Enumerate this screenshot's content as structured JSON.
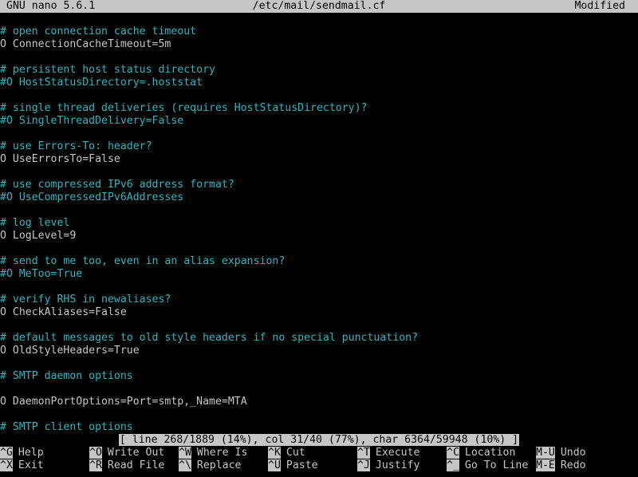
{
  "title_bar": {
    "app": "GNU nano 5.6.1",
    "file": "/etc/mail/sendmail.cf",
    "state": "Modified"
  },
  "lines": [
    {
      "text": "# open connection cache timeout",
      "kind": "comment"
    },
    {
      "text": "O ConnectionCacheTimeout=5m",
      "kind": "code"
    },
    {
      "text": "",
      "kind": "code"
    },
    {
      "text": "# persistent host status directory",
      "kind": "comment"
    },
    {
      "text": "#O HostStatusDirectory=.hoststat",
      "kind": "comment"
    },
    {
      "text": "",
      "kind": "code"
    },
    {
      "text": "# single thread deliveries (requires HostStatusDirectory)?",
      "kind": "comment"
    },
    {
      "text": "#O SingleThreadDelivery=False",
      "kind": "comment"
    },
    {
      "text": "",
      "kind": "code"
    },
    {
      "text": "# use Errors-To: header?",
      "kind": "comment"
    },
    {
      "text": "O UseErrorsTo=False",
      "kind": "code"
    },
    {
      "text": "",
      "kind": "code"
    },
    {
      "text": "# use compressed IPv6 address format?",
      "kind": "comment"
    },
    {
      "text": "#O UseCompressedIPv6Addresses",
      "kind": "comment"
    },
    {
      "text": "",
      "kind": "code"
    },
    {
      "text": "# log level",
      "kind": "comment"
    },
    {
      "text": "O LogLevel=9",
      "kind": "code"
    },
    {
      "text": "",
      "kind": "code"
    },
    {
      "text": "# send to me too, even in an alias expansion?",
      "kind": "comment"
    },
    {
      "text": "#O MeToo=True",
      "kind": "comment"
    },
    {
      "text": "",
      "kind": "code"
    },
    {
      "text": "# verify RHS in newaliases?",
      "kind": "comment"
    },
    {
      "text": "O CheckAliases=False",
      "kind": "code"
    },
    {
      "text": "",
      "kind": "code"
    },
    {
      "text": "# default messages to old style headers if no special punctuation?",
      "kind": "comment"
    },
    {
      "text": "O OldStyleHeaders=True",
      "kind": "code"
    },
    {
      "text": "",
      "kind": "code"
    },
    {
      "text": "# SMTP daemon options",
      "kind": "comment"
    },
    {
      "text": "",
      "kind": "code"
    },
    {
      "text": "O DaemonPortOptions=Port=smtp,_Name=MTA",
      "kind": "code"
    },
    {
      "text": "",
      "kind": "code"
    },
    {
      "text": "# SMTP client options",
      "kind": "comment"
    }
  ],
  "status": "[ line 268/1889 (14%), col 31/40 (77%), char 6364/59948 (10%) ]",
  "shortcuts": {
    "row1": [
      {
        "key": "^G",
        "label": "Help",
        "icon": "help-shortcut"
      },
      {
        "key": "^O",
        "label": "Write Out",
        "icon": "write-out-shortcut"
      },
      {
        "key": "^W",
        "label": "Where Is",
        "icon": "where-is-shortcut"
      },
      {
        "key": "^K",
        "label": "Cut",
        "icon": "cut-shortcut"
      },
      {
        "key": "^T",
        "label": "Execute",
        "icon": "execute-shortcut"
      },
      {
        "key": "^C",
        "label": "Location",
        "icon": "location-shortcut"
      },
      {
        "key": "M-U",
        "label": "Undo",
        "icon": "undo-shortcut"
      }
    ],
    "row2": [
      {
        "key": "^X",
        "label": "Exit",
        "icon": "exit-shortcut"
      },
      {
        "key": "^R",
        "label": "Read File",
        "icon": "read-file-shortcut"
      },
      {
        "key": "^\\",
        "label": "Replace",
        "icon": "replace-shortcut"
      },
      {
        "key": "^U",
        "label": "Paste",
        "icon": "paste-shortcut"
      },
      {
        "key": "^J",
        "label": "Justify",
        "icon": "justify-shortcut"
      },
      {
        "key": "^_",
        "label": "Go To Line",
        "icon": "go-to-line-shortcut"
      },
      {
        "key": "M-E",
        "label": "Redo",
        "icon": "redo-shortcut"
      }
    ]
  },
  "colors": {
    "bar_bg": "#c6c6c6",
    "bar_fg": "#000000",
    "comment": "#29b8c3",
    "code": "#c6c6c6",
    "background": "#000000"
  }
}
